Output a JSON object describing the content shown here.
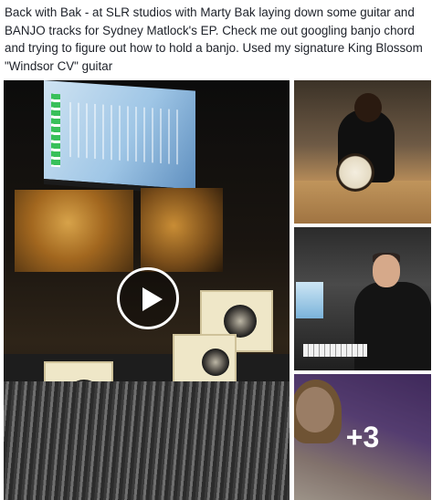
{
  "post": {
    "text": "Back with Bak - at SLR studios with Marty Bak laying down some guitar and BANJO tracks for Sydney Matlock's EP. Check me out googling banjo chord and trying to figure out how to hold a banjo. Used my signature King Blossom \"Windsor CV\" guitar"
  },
  "media": {
    "main_video": {
      "icon": "play-icon"
    },
    "thumbnails": [
      {
        "subject": "banjo-practice-photo"
      },
      {
        "subject": "studio-engineer-photo"
      },
      {
        "subject": "more-photos-thumbnail",
        "overlay_label": "+3"
      }
    ]
  }
}
